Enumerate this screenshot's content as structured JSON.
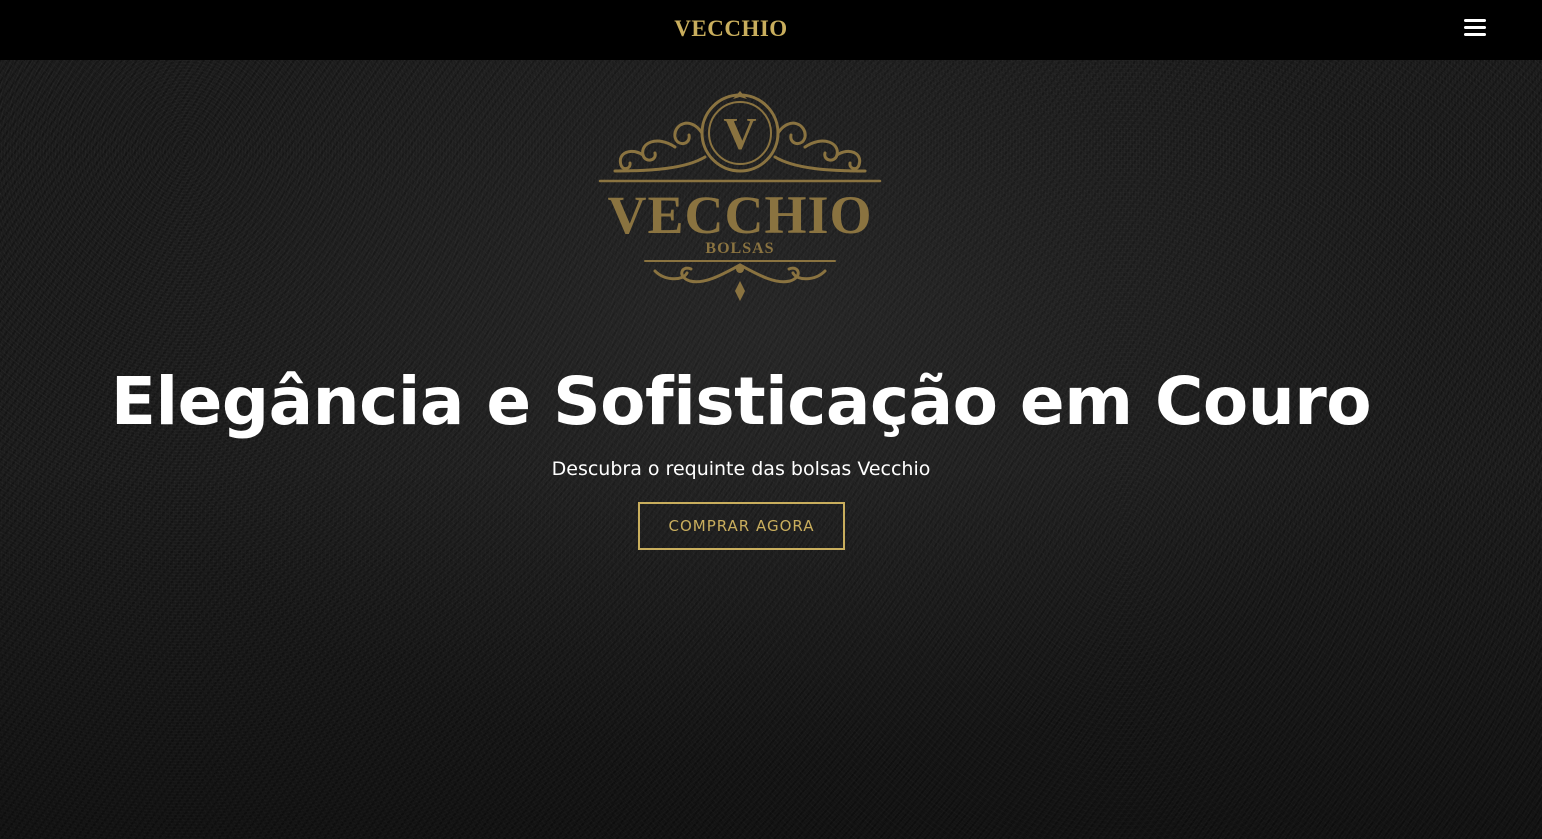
{
  "navbar": {
    "brand": "VECCHIO",
    "menu_icon": "hamburger-menu-icon"
  },
  "hero": {
    "logo": {
      "monogram": "V",
      "name": "VECCHIO",
      "tagline": "BOLSAS"
    },
    "headline": "Elegância e Sofisticação em Couro",
    "subheadline": "Descubra o requinte das bolsas Vecchio",
    "cta_label": "COMPRAR AGORA"
  },
  "colors": {
    "accent_gold": "#c9ae5d",
    "navbar_bg": "#000000",
    "text_white": "#ffffff",
    "background_leather": "#1b1b1b"
  }
}
